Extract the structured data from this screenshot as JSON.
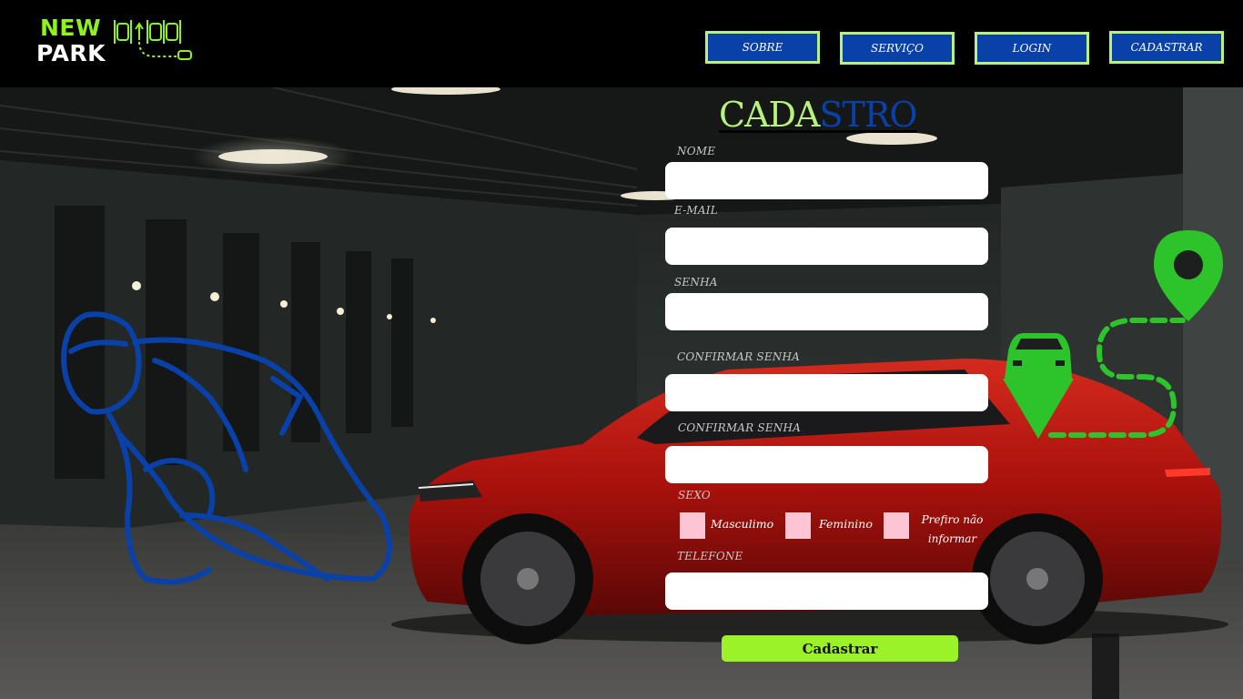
{
  "header": {
    "logo": {
      "word1": "NEW",
      "word2": "PARK"
    },
    "nav": [
      "SOBRE",
      "SERVIÇO",
      "LOGIN",
      "CADASTRAR"
    ]
  },
  "form": {
    "title_part1": "CADA",
    "title_part2": "STRO",
    "labels": {
      "nome": "NOME",
      "email": "E-MAIL",
      "senha": "SENHA",
      "confirmar1": "CONFIRMAR SENHA",
      "confirmar2": "CONFIRMAR SENHA",
      "sexo": "SEXO",
      "telefone": "TELEFONE"
    },
    "values": {
      "nome": "",
      "email": "",
      "senha": "",
      "confirmar1": "",
      "confirmar2": "",
      "telefone": ""
    },
    "sexo_options": [
      "Masculimo",
      "Feminino",
      "Prefiro não informar"
    ],
    "submit_label": "Cadastrar"
  },
  "colors": {
    "accent_green": "#9cf229",
    "nav_blue": "#0a41a8",
    "nav_border": "#b9f27a",
    "checkbox_pink": "#fdc4d4",
    "car_red": "#b3120e",
    "icon_green": "#2cc42a"
  }
}
